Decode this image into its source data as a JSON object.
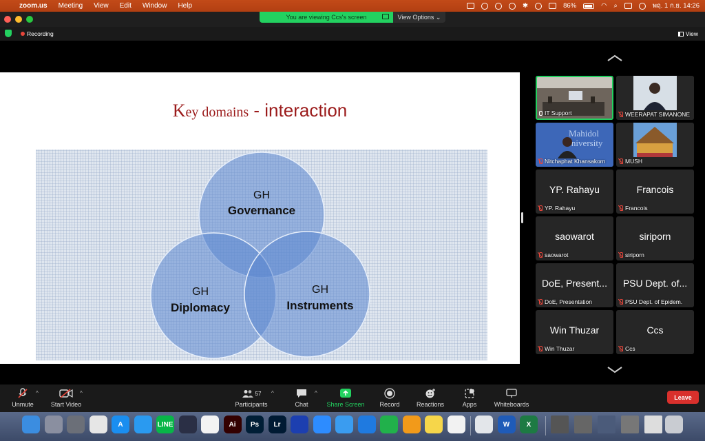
{
  "menubar": {
    "app": "zoom.us",
    "items": [
      "Meeting",
      "View",
      "Edit",
      "Window",
      "Help"
    ],
    "battery": "86%",
    "date_time": "พฤ. 1 ก.ย.  14:26"
  },
  "zoom": {
    "viewing_text": "You are viewing Ccs's screen",
    "view_options": "View Options",
    "recording": "Recording",
    "view": "View"
  },
  "slide": {
    "title_k": "K",
    "title_ey": "ey domains",
    "title_rest": " - interaction",
    "circles": [
      {
        "line1": "GH",
        "line2": "Governance"
      },
      {
        "line1": "GH",
        "line2": "Diplomacy"
      },
      {
        "line1": "GH",
        "line2": "Instruments"
      }
    ]
  },
  "participants": [
    {
      "name": "IT Support",
      "display": "",
      "active": true,
      "mic": "on",
      "picture": "room"
    },
    {
      "name": "WEERAPAT SIMANONE",
      "display": "",
      "mic": "muted",
      "picture": "person"
    },
    {
      "name": "Nitchaphat Khansakorn",
      "display": "",
      "mic": "muted",
      "picture": "mahidol",
      "bg_text": [
        "Mahidol",
        "University"
      ]
    },
    {
      "name": "MUSH",
      "display": "",
      "mic": "muted",
      "picture": "building"
    },
    {
      "name": "YP. Rahayu",
      "display": "YP. Rahayu",
      "mic": "muted"
    },
    {
      "name": "Francois",
      "display": "Francois",
      "mic": "muted"
    },
    {
      "name": "saowarot",
      "display": "saowarot",
      "mic": "muted"
    },
    {
      "name": "siriporn",
      "display": "siriporn",
      "mic": "muted"
    },
    {
      "name": "DoE, Presentation",
      "display": "DoE, Present...",
      "mic": "muted"
    },
    {
      "name": "PSU Dept. of Epidem.",
      "display": "PSU Dept. of...",
      "mic": "muted"
    },
    {
      "name": "Win Thuzar",
      "display": "Win Thuzar",
      "mic": "muted"
    },
    {
      "name": "Ccs",
      "display": "Ccs",
      "mic": "muted"
    }
  ],
  "toolbar": {
    "unmute": "Unmute",
    "start_video": "Start Video",
    "participants": "Participants",
    "participants_count": "57",
    "chat": "Chat",
    "share_screen": "Share Screen",
    "record": "Record",
    "reactions": "Reactions",
    "apps": "Apps",
    "whiteboards": "Whiteboards",
    "leave": "Leave"
  },
  "dock": {
    "apps": [
      {
        "name": "finder",
        "label": "",
        "color": "#3b8de0"
      },
      {
        "name": "launchpad",
        "label": "",
        "color": "#8a8fa0"
      },
      {
        "name": "system-preferences",
        "label": "",
        "color": "#6b6f78"
      },
      {
        "name": "keynote-remote",
        "label": "",
        "color": "#e6e6e6"
      },
      {
        "name": "app-store",
        "label": "A",
        "color": "#1a8ef0"
      },
      {
        "name": "safari",
        "label": "",
        "color": "#2a9af0"
      },
      {
        "name": "line",
        "label": "LINE",
        "color": "#08b648"
      },
      {
        "name": "davinci",
        "label": "",
        "color": "#2a2f45"
      },
      {
        "name": "photos",
        "label": "",
        "color": "#f3f3f3"
      },
      {
        "name": "illustrator",
        "label": "Ai",
        "color": "#330000"
      },
      {
        "name": "photoshop",
        "label": "Ps",
        "color": "#001e36"
      },
      {
        "name": "lightroom",
        "label": "Lr",
        "color": "#001a33"
      },
      {
        "name": "webex",
        "label": "",
        "color": "#1c3fb0"
      },
      {
        "name": "zoom",
        "label": "",
        "color": "#2d8cff"
      },
      {
        "name": "mail",
        "label": "",
        "color": "#3a9cf0"
      },
      {
        "name": "keynote",
        "label": "",
        "color": "#1f7ae0"
      },
      {
        "name": "numbers",
        "label": "",
        "color": "#21b14b"
      },
      {
        "name": "pages",
        "label": "",
        "color": "#f29a1a"
      },
      {
        "name": "notes",
        "label": "",
        "color": "#f6d64a"
      },
      {
        "name": "reminders",
        "label": "",
        "color": "#f2f2f2"
      },
      {
        "name": "preview",
        "label": "",
        "color": "#e3e6ea"
      },
      {
        "name": "word",
        "label": "W",
        "color": "#1f5bb8"
      },
      {
        "name": "excel",
        "label": "X",
        "color": "#1d7a43"
      }
    ]
  }
}
